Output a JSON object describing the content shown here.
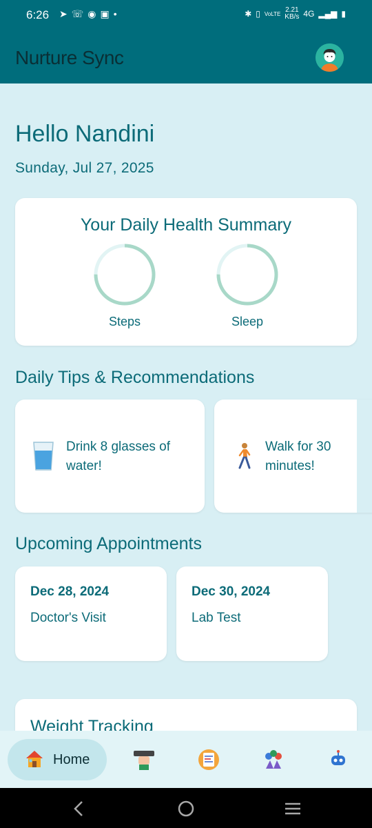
{
  "status_bar": {
    "time": "6:26",
    "left_icons": [
      "telegram-icon",
      "call-icon",
      "app-icon",
      "vivo-icon",
      "dot-icon"
    ],
    "speed_value": "2.21",
    "speed_unit": "KB/s",
    "network": "4G",
    "right_icons": [
      "bluetooth-icon",
      "vibrate-icon",
      "volte-icon",
      "signal-icon",
      "battery-icon"
    ]
  },
  "app_bar": {
    "title": "Nurture Sync",
    "avatar_icon": "user-avatar-icon"
  },
  "greeting": {
    "text": "Hello Nandini",
    "date": "Sunday, Jul 27, 2025"
  },
  "summary": {
    "title": "Your Daily Health Summary",
    "rings": [
      {
        "label": "Steps",
        "progress": 0.75
      },
      {
        "label": "Sleep",
        "progress": 0.75
      }
    ],
    "ring_color": "#a8d8c8",
    "ring_track_color": "#e2f4f4"
  },
  "tips": {
    "title": "Daily Tips & Recommendations",
    "items": [
      {
        "icon": "water-glass-icon",
        "text": "Drink 8 glasses of water!"
      },
      {
        "icon": "walking-person-icon",
        "text": "Walk for 30 minutes!"
      }
    ]
  },
  "appointments": {
    "title": "Upcoming Appointments",
    "items": [
      {
        "date": "Dec 28, 2024",
        "type": "Doctor's Visit"
      },
      {
        "date": "Dec 30, 2024",
        "type": "Lab Test"
      }
    ]
  },
  "weight": {
    "title": "Weight Tracking"
  },
  "bottom_nav": {
    "items": [
      {
        "icon": "home-icon",
        "label": "Home",
        "active": true
      },
      {
        "icon": "fitness-icon",
        "label": ""
      },
      {
        "icon": "report-icon",
        "label": ""
      },
      {
        "icon": "community-icon",
        "label": ""
      },
      {
        "icon": "bot-icon",
        "label": ""
      }
    ]
  },
  "colors": {
    "primary": "#006d7c",
    "text_teal": "#0c6b78",
    "background": "#d8eff4",
    "nav_active": "#c3e6ec"
  }
}
